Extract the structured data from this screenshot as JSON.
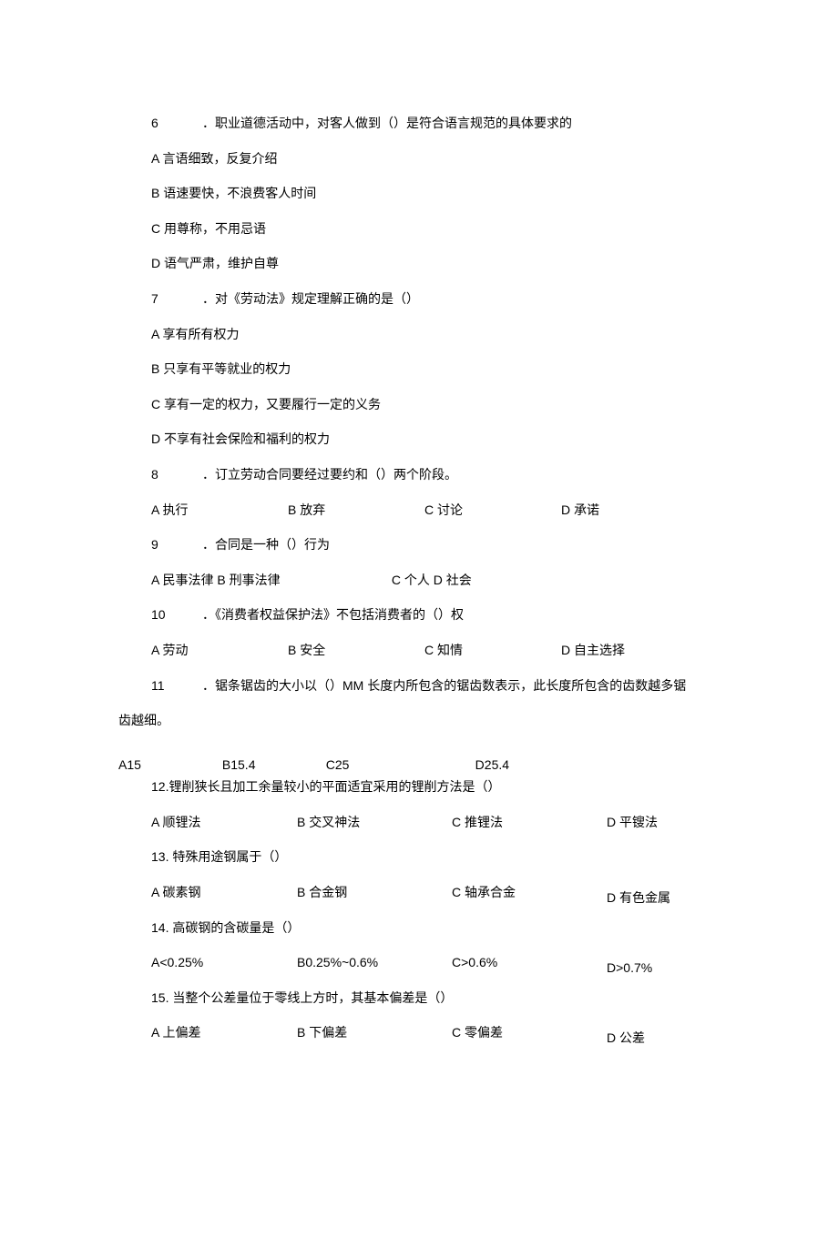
{
  "q6": {
    "num": "6",
    "stem": "．职业道德活动中，对客人做到（）是符合语言规范的具体要求的",
    "A": "A 言语细致，反复介绍",
    "B": "B 语速要快，不浪费客人时间",
    "C": "C 用尊称，不用忌语",
    "D": "D 语气严肃，维护自尊"
  },
  "q7": {
    "num": "7",
    "stem": "．对《劳动法》规定理解正确的是（）",
    "A": "A 享有所有权力",
    "B": "B 只享有平等就业的权力",
    "C": "C 享有一定的权力，又要履行一定的义务",
    "D": "D 不享有社会保险和福利的权力"
  },
  "q8": {
    "num": "8",
    "stem": "．订立劳动合同要经过要约和（）两个阶段。",
    "A": "A 执行",
    "B": "B 放弃",
    "C": "C 讨论",
    "D": "D 承诺"
  },
  "q9": {
    "num": "9",
    "stem": "．合同是一种（）行为",
    "AB": "A 民事法律 B 刑事法律",
    "CD": "C 个人 D 社会"
  },
  "q10": {
    "num": "10",
    "stem": "．《消费者权益保护法》不包括消费者的（）权",
    "A": "A 劳动",
    "B": "B 安全",
    "C": "C 知情",
    "D": "D 自主选择"
  },
  "q11": {
    "num": "11",
    "stem": "．锯条锯齿的大小以（）MM 长度内所包含的锯齿数表示，此长度所包含的齿数越多锯",
    "cont": "齿越细。",
    "A": "A15",
    "B": "B15.4",
    "C": "C25",
    "D": "D25.4"
  },
  "q12": {
    "stem": "12.锂削狭长且加工余量较小的平面适宜采用的锂削方法是（）",
    "A": "A 顺锂法",
    "B": "B 交叉神法",
    "C": "C 推锂法",
    "D": "D 平锼法"
  },
  "q13": {
    "stem": "13. 特殊用途钢属于（）",
    "A": "A 碳素钢",
    "B": "B 合金钢",
    "C": "C 轴承合金",
    "D": "D 有色金属"
  },
  "q14": {
    "stem": "14. 高碳钢的含碳量是（）",
    "A": "A<0.25%",
    "B": "B0.25%~0.6%",
    "C": "C>0.6%",
    "D": "D>0.7%"
  },
  "q15": {
    "stem": "15. 当整个公差量位于零线上方时，其基本偏差是（）",
    "A": "A 上偏差",
    "B": "B 下偏差",
    "C": "C 零偏差",
    "D": "D 公差"
  }
}
